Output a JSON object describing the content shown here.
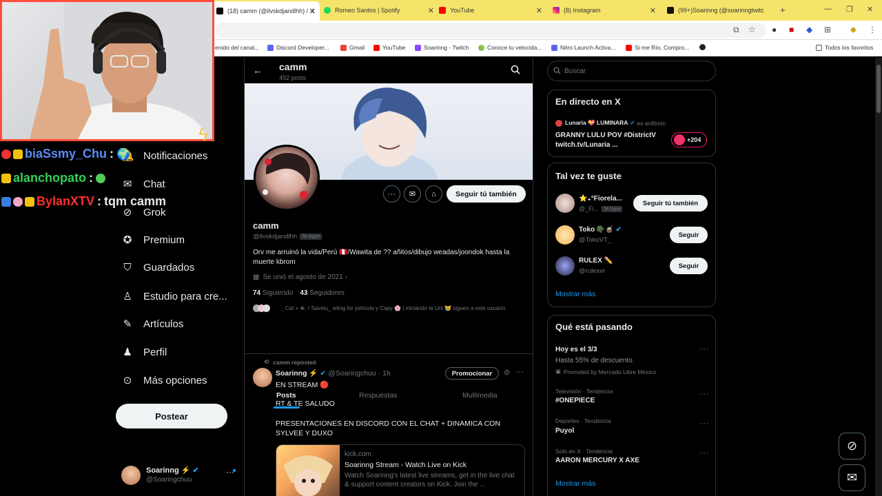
{
  "browser": {
    "tabs": [
      {
        "title": "(18) camm (@ilvskdjandlhh) / X",
        "icon": "x-icon"
      },
      {
        "title": "Romeo Santos | Spotify",
        "icon": "spotify-icon"
      },
      {
        "title": "YouTube",
        "icon": "youtube-icon"
      },
      {
        "title": "(8) Instagram",
        "icon": "instagram-icon"
      },
      {
        "title": "(99+)Soarinng (@soarinngtwitc",
        "icon": "tiktok-icon"
      }
    ],
    "bookmarks": [
      "enido del canal...",
      "Discord Developer...",
      "Gmail",
      "YouTube",
      "Soarinng - Twitch",
      "Conoce tu velocida...",
      "Nitro Launch Activa...",
      "Si me Río, Compro...",
      "",
      "Todos los favoritos"
    ]
  },
  "sidebar": {
    "items": [
      {
        "label": "Notificaciones",
        "icon": "bell-icon"
      },
      {
        "label": "Chat",
        "icon": "envelope-icon"
      },
      {
        "label": "Grok",
        "icon": "grok-icon"
      },
      {
        "label": "Premium",
        "icon": "verified-icon"
      },
      {
        "label": "Guardados",
        "icon": "bookmark-icon"
      },
      {
        "label": "Estudio para cre...",
        "icon": "creator-studio-icon"
      },
      {
        "label": "Artículos",
        "icon": "articles-icon"
      },
      {
        "label": "Perfil",
        "icon": "person-icon"
      },
      {
        "label": "Más opciones",
        "icon": "more-circle-icon"
      }
    ],
    "post_label": "Postear",
    "account": {
      "name": "Soarinng ⚡",
      "handle": "@Soaringchuu"
    }
  },
  "profile": {
    "header_name": "camm",
    "post_count": "492 posts",
    "name": "camm",
    "handle": "@ilvskdjandlhh",
    "follows_you": "Te sigue",
    "bio": "Orv me arruinó la vida/Perú 🇵🇪/Wawita de ?? añitos/dibujo weadas/joondok hasta la muerte kbrom",
    "joined": "Se unió el agosto de 2021",
    "following_count": "74",
    "following_label": "Siguiendo",
    "followers_count": "43",
    "followers_label": "Seguidores",
    "followed_by": "˳ Cat + ❀. ᵡ Savelu_ wting for película y Capy 🌸 | iniciando la Uni 😿 siguen a este usuario",
    "follow_back": "Seguir tú también",
    "tabs": [
      "Posts",
      "Respuestas",
      "Multimedia"
    ]
  },
  "post": {
    "repost_note": "camm reposteó",
    "author": "Soarinng ⚡",
    "handle": "@Soaringchuu",
    "time": "· 1h",
    "promote": "Promocionar",
    "lines": [
      "EN STREAM 🔴",
      "RT & TE SALUDO",
      "PRESENTACIONES EN DISCORD CON EL CHAT + DINAMICA CON SYLVEE Y DUXO"
    ],
    "card": {
      "domain": "kick.com",
      "title": "Soarinng Stream - Watch Live on Kick",
      "desc": "Watch Soarinng's latest live streams, get in the live chat & support content creators on Kick. Join the ..."
    }
  },
  "right": {
    "search_placeholder": "Buscar",
    "live": {
      "title": "En directo en X",
      "host": "Lunaria 💝 LUMINARA",
      "host_role": "es anfitrión",
      "event": "GRANNY LULU POV #DistrictV twitch.tv/Lunaria ...",
      "listeners": "+204"
    },
    "suggest": {
      "title": "Tal vez te guste",
      "users": [
        {
          "name": "⭐₊°Fiorela...",
          "handle": "@_Fi...",
          "badge": "Te sigue",
          "button": "Seguir tú también"
        },
        {
          "name": "Toko 🪖🧉",
          "handle": "@TokoVT_",
          "badge": "",
          "button": "Seguir"
        },
        {
          "name": "RULEX ✏️",
          "handle": "@rulexvr",
          "badge": "",
          "button": "Seguir"
        }
      ],
      "more": "Mostrar más"
    },
    "trends": {
      "title": "Qué está pasando",
      "items": [
        {
          "context": "",
          "title": "Hoy es el 3/3",
          "sub": "Hasta 55% de descuento.",
          "promo": "Promoted by Mercado Libre México"
        },
        {
          "context": "Televisión · Tendencia",
          "title": "#ONEPIECE",
          "sub": "",
          "promo": ""
        },
        {
          "context": "Deportes · Tendencia",
          "title": "Puyol",
          "sub": "",
          "promo": ""
        },
        {
          "context": "Solo en X · Tendencia",
          "title": "AARON MERCURY X AXE",
          "sub": "",
          "promo": ""
        }
      ],
      "more": "Mostrar más"
    }
  },
  "overlay_chat": [
    {
      "user": "biaSsmy_Chu",
      "sep": ":",
      "message": "",
      "color": "#5a8df5"
    },
    {
      "user": "alanchopato",
      "sep": ":",
      "message": "",
      "color": "#33d158"
    },
    {
      "user": "BylanXTV",
      "sep": ":",
      "message": "tqm camm",
      "color": "#ff2d2d"
    }
  ],
  "colors": {
    "verified": "#1d9bf0",
    "tab_bar": "#f6e46a",
    "cam_border": "#ff4d3d"
  }
}
